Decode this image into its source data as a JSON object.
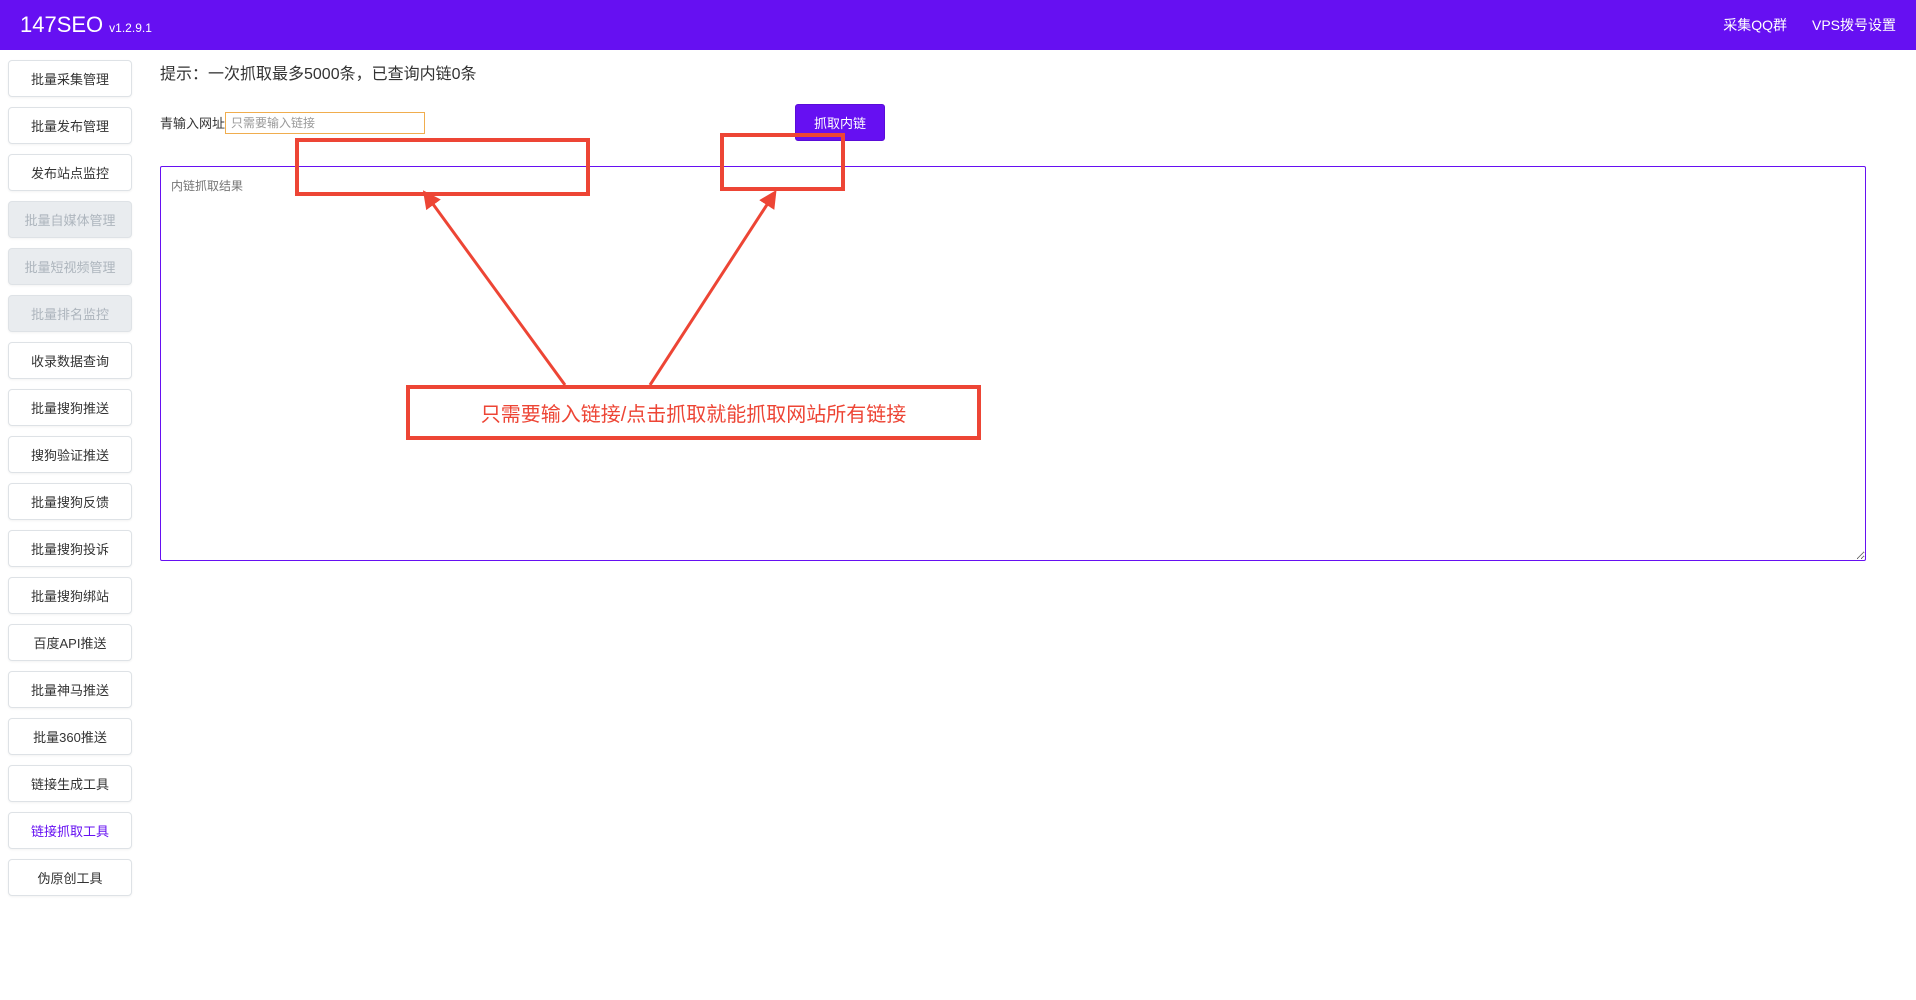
{
  "header": {
    "title": "147SEO",
    "version": "v1.2.9.1",
    "links": {
      "qq_group": "采集QQ群",
      "vps_settings": "VPS拨号设置"
    }
  },
  "sidebar": {
    "items": [
      {
        "label": "批量采集管理",
        "disabled": false,
        "active": false
      },
      {
        "label": "批量发布管理",
        "disabled": false,
        "active": false
      },
      {
        "label": "发布站点监控",
        "disabled": false,
        "active": false
      },
      {
        "label": "批量自媒体管理",
        "disabled": true,
        "active": false
      },
      {
        "label": "批量短视频管理",
        "disabled": true,
        "active": false
      },
      {
        "label": "批量排名监控",
        "disabled": true,
        "active": false
      },
      {
        "label": "收录数据查询",
        "disabled": false,
        "active": false
      },
      {
        "label": "批量搜狗推送",
        "disabled": false,
        "active": false
      },
      {
        "label": "搜狗验证推送",
        "disabled": false,
        "active": false
      },
      {
        "label": "批量搜狗反馈",
        "disabled": false,
        "active": false
      },
      {
        "label": "批量搜狗投诉",
        "disabled": false,
        "active": false
      },
      {
        "label": "批量搜狗绑站",
        "disabled": false,
        "active": false
      },
      {
        "label": "百度API推送",
        "disabled": false,
        "active": false
      },
      {
        "label": "批量神马推送",
        "disabled": false,
        "active": false
      },
      {
        "label": "批量360推送",
        "disabled": false,
        "active": false
      },
      {
        "label": "链接生成工具",
        "disabled": false,
        "active": false
      },
      {
        "label": "链接抓取工具",
        "disabled": false,
        "active": true
      },
      {
        "label": "伪原创工具",
        "disabled": false,
        "active": false
      }
    ]
  },
  "main": {
    "hint": "提示：一次抓取最多5000条，已查询内链0条",
    "input_label": "青输入网址",
    "input_placeholder": "只需要输入链接",
    "fetch_button": "抓取内链",
    "result_placeholder": "内链抓取结果",
    "annotation": "只需要输入链接/点击抓取就能抓取网站所有链接"
  },
  "colors": {
    "primary": "#6610f2",
    "highlight": "#ed4535",
    "input_border": "#f0ad4e"
  }
}
